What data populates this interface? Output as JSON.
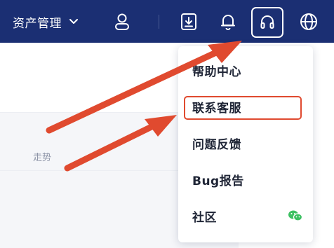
{
  "header": {
    "menu_label": "资产管理",
    "icons": [
      "chevron-down",
      "user",
      "download",
      "bell",
      "headset",
      "globe"
    ]
  },
  "background": {
    "trend_label": "走势"
  },
  "dropdown": {
    "items": [
      {
        "label": "帮助中心"
      },
      {
        "label": "联系客服"
      },
      {
        "label": "问题反馈"
      },
      {
        "label": "Bug报告"
      },
      {
        "label": "社区"
      }
    ]
  },
  "colors": {
    "nav_bg": "#1b2f73",
    "annotation_red": "#e04a2f",
    "wechat_green": "#3cc062"
  }
}
